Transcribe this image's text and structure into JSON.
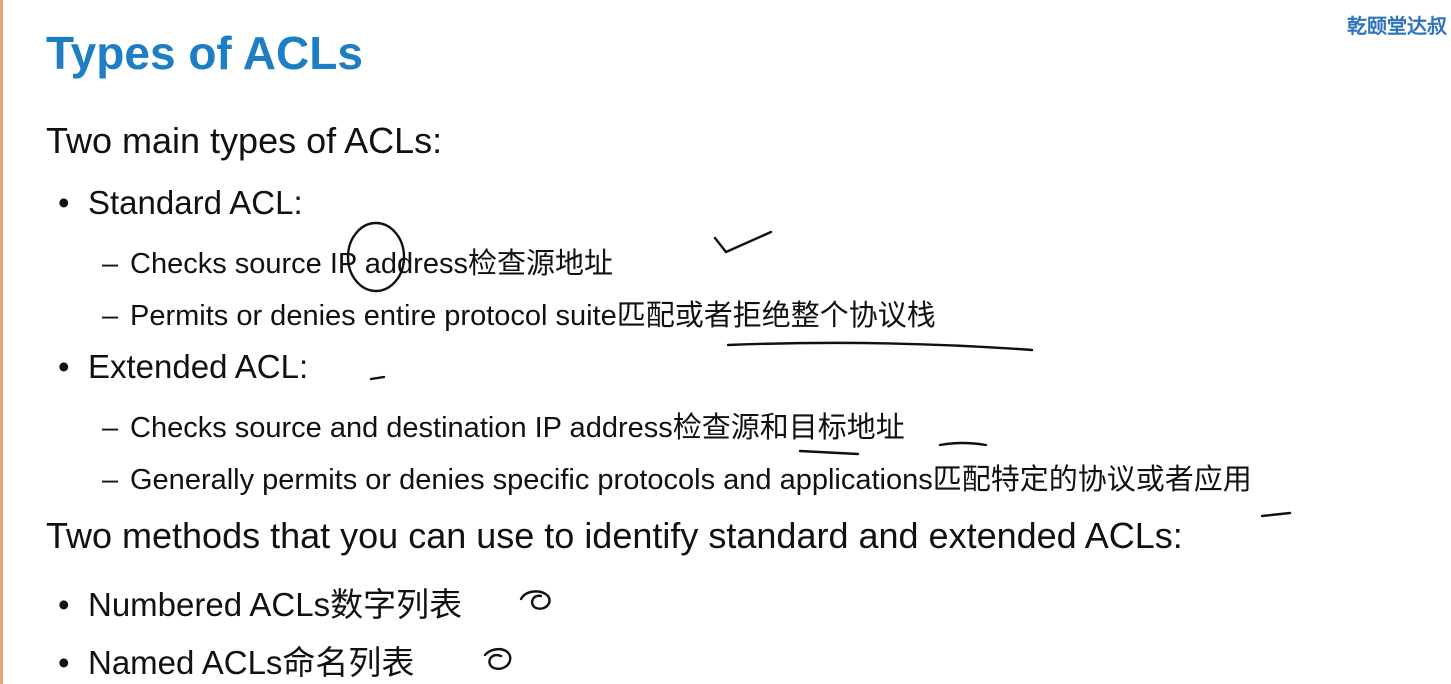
{
  "watermark": "乾颐堂达叔",
  "slide": {
    "title": "Types of ACLs",
    "intro1": "Two main types of ACLs:",
    "standard": {
      "label": "Standard ACL:",
      "points": [
        "Checks source IP address检查源地址",
        "Permits or denies entire protocol suite匹配或者拒绝整个协议栈"
      ]
    },
    "extended": {
      "label": "Extended ACL:",
      "points": [
        "Checks source and destination IP address检查源和目标地址",
        "Generally permits or denies specific protocols and applications匹配特定的协议或者应用"
      ]
    },
    "intro2": "Two methods that you can use to identify standard and extended ACLs:",
    "methods": [
      "Numbered ACLs数字列表",
      "Named ACLs命名列表"
    ]
  },
  "symbols": {
    "bullet": "•",
    "dash": "–"
  }
}
